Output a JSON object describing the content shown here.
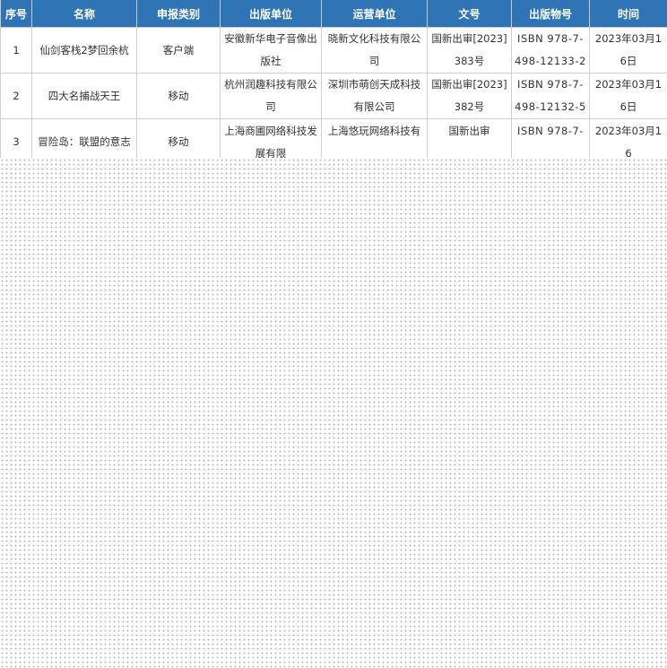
{
  "table": {
    "headers": [
      "序号",
      "名称",
      "申报类别",
      "出版单位",
      "运营单位",
      "文号",
      "出版物号",
      "时间"
    ],
    "rows": [
      {
        "index": "1",
        "name": "仙剑客栈2梦回余杭",
        "category": "客户端",
        "publisher": "安徽新华电子音像出版社",
        "operator": "晓新文化科技有限公司",
        "doc_no": "国新出审[2023]383号",
        "isbn": "ISBN 978-7-498-12133-2",
        "date": "2023年03月16日"
      },
      {
        "index": "2",
        "name": "四大名捕战天王",
        "category": "移动",
        "publisher": "杭州润趣科技有限公司",
        "operator": "深圳市萌创天成科技有限公司",
        "doc_no": "国新出审[2023]382号",
        "isbn": "ISBN 978-7-498-12132-5",
        "date": "2023年03月16日"
      },
      {
        "index": "3",
        "name": "冒险岛：联盟的意志",
        "category": "移动",
        "publisher": "上海商圃网络科技发展有限",
        "operator": "上海悠玩网络科技有",
        "doc_no": "国新出审",
        "isbn": "ISBN 978-7-",
        "date": "2023年03月16"
      }
    ]
  }
}
